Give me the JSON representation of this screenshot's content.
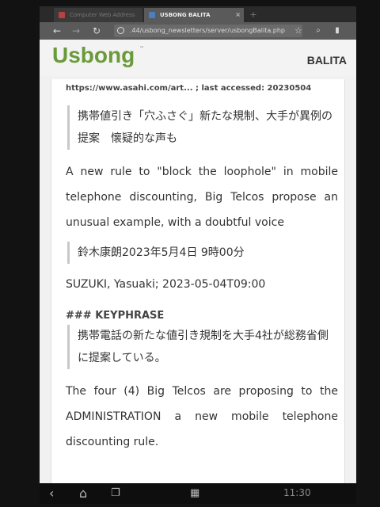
{
  "browser": {
    "tabs": [
      {
        "label": "Computer Web Address",
        "active": false
      },
      {
        "label": "USBONG BALITA",
        "active": true
      }
    ],
    "new_tab_label": "+",
    "close_label": "×",
    "url": ".44/usbong_newsletters/server/usbongBalita.php"
  },
  "page": {
    "logo": "Usbong",
    "logo_tm": "™",
    "section_title": "BALITA"
  },
  "article": {
    "source": "https://www.asahi.com/art... ; last accessed: 20230504",
    "headline_ja": "携帯値引き「穴ふさぐ」新たな規制、大手が異例の提案　懐疑的な声も",
    "headline_en": "A new rule to \"block the loophole\" in mobile telephone discounting, Big Telcos propose an unusual example, with a doubtful voice",
    "byline_ja": "鈴木康朗2023年5月4日 9時00分",
    "byline_en": "SUZUKI, Yasuaki; 2023-05-04T09:00",
    "keyphrase_heading": "### KEYPHRASE",
    "keyphrase_ja": "携帯電話の新たな値引き規制を大手4社が総務省側に提案している。",
    "keyphrase_en": "The four (4) Big Telcos are proposing to the ADMINISTRATION a new mobile telephone discounting rule."
  },
  "system": {
    "clock": "11:30",
    "icons": [
      "back-icon",
      "home-icon",
      "recent-apps-icon",
      "apps-grid-icon"
    ]
  },
  "colors": {
    "logo_green": "#6a9a3a",
    "page_bg": "#f1f1f1",
    "card_bg": "#ffffff",
    "chrome_bg": "#5a5a5a"
  }
}
